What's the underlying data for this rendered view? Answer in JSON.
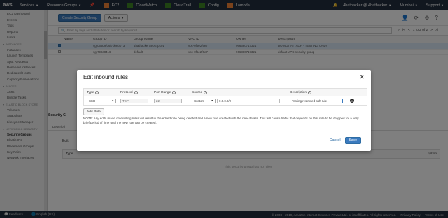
{
  "topnav": {
    "logo": "aws",
    "services": "Services",
    "resource_groups": "Resource Groups",
    "shortcuts": [
      {
        "label": "EC2",
        "color": "#f58536"
      },
      {
        "label": "CloudWatch",
        "color": "#3f8624"
      },
      {
        "label": "CloudTrail",
        "color": "#3f8624"
      },
      {
        "label": "Config",
        "color": "#3f8624"
      },
      {
        "label": "Lambda",
        "color": "#f58536"
      }
    ],
    "account": "4hathacker @ 4hathacker",
    "region": "Mumbai",
    "support": "Support"
  },
  "sidebar": {
    "items": [
      {
        "type": "item",
        "label": "EC2 Dashboard"
      },
      {
        "type": "item",
        "label": "Events"
      },
      {
        "type": "item",
        "label": "Tags"
      },
      {
        "type": "item",
        "label": "Reports"
      },
      {
        "type": "item",
        "label": "Limits"
      },
      {
        "type": "section",
        "label": "INSTANCES"
      },
      {
        "type": "item",
        "label": "Instances"
      },
      {
        "type": "item",
        "label": "Launch Templates"
      },
      {
        "type": "item",
        "label": "Spot Requests"
      },
      {
        "type": "item",
        "label": "Reserved Instances"
      },
      {
        "type": "item",
        "label": "Dedicated Hosts"
      },
      {
        "type": "item",
        "label": "Capacity Reservations"
      },
      {
        "type": "section",
        "label": "IMAGES"
      },
      {
        "type": "item",
        "label": "AMIs"
      },
      {
        "type": "item",
        "label": "Bundle Tasks"
      },
      {
        "type": "section",
        "label": "ELASTIC BLOCK STORE"
      },
      {
        "type": "item",
        "label": "Volumes"
      },
      {
        "type": "item",
        "label": "Snapshots"
      },
      {
        "type": "item",
        "label": "Lifecycle Manager"
      },
      {
        "type": "section",
        "label": "NETWORK & SECURITY"
      },
      {
        "type": "item",
        "label": "Security Groups",
        "active": true
      },
      {
        "type": "item",
        "label": "Elastic IPs"
      },
      {
        "type": "item",
        "label": "Placement Groups"
      },
      {
        "type": "item",
        "label": "Key Pairs"
      },
      {
        "type": "item",
        "label": "Network Interfaces"
      }
    ]
  },
  "toolbar": {
    "create_label": "Create Security Group",
    "actions_label": "Actions"
  },
  "filter": {
    "placeholder": "Filter by tags and attributes or search by keyword",
    "pager": "1 to 2 of 2"
  },
  "table": {
    "headers": [
      "Name",
      "Group ID",
      "Group Name",
      "VPC ID",
      "Owner",
      "Description"
    ],
    "rows": [
      {
        "name": "",
        "group_id": "sg-065d9f06f7d0eb073",
        "group_name": "4hathackerSecGrp101",
        "vpc": "vpc-0f5e2f6e7",
        "owner": "966380717321",
        "desc": "DO NOT ATTACH - TESTING ONLY",
        "selected": true
      },
      {
        "name": "",
        "group_id": "sg-798c8416",
        "group_name": "default",
        "vpc": "vpc-0f5e2f6e7",
        "owner": "966380717321",
        "desc": "default VPC security group",
        "selected": false
      }
    ]
  },
  "lower": {
    "title": "Security G",
    "tab": "Descripti",
    "edit": "Edit",
    "type_head": "Type",
    "desc_head": "ription",
    "no_rules": "This security group has no rules"
  },
  "modal": {
    "title": "Edit inbound rules",
    "headers": {
      "type": "Type",
      "protocol": "Protocol",
      "port": "Port Range",
      "source": "Source",
      "description": "Description"
    },
    "rule": {
      "type": "SSH",
      "protocol": "TCP",
      "port": "22",
      "source_mode": "Custom",
      "source_value": "0.0.0.0/0",
      "description": "Testing restricted-ssh rule"
    },
    "add_rule": "Add Rule",
    "note": "NOTE: Any edits made on existing rules will result in the edited rule being deleted and a new rule created with the new details. This will cause traffic that depends on that rule to be dropped for a very brief period of time until the new rule can be created.",
    "cancel": "Cancel",
    "save": "Save"
  },
  "footer": {
    "feedback": "Feedback",
    "language": "English (US)",
    "copyright": "© 2008 - 2019, Amazon Internet Services Private Ltd. or its affiliates. All rights reserved.",
    "privacy": "Privacy Policy",
    "terms": "Terms of Use"
  }
}
